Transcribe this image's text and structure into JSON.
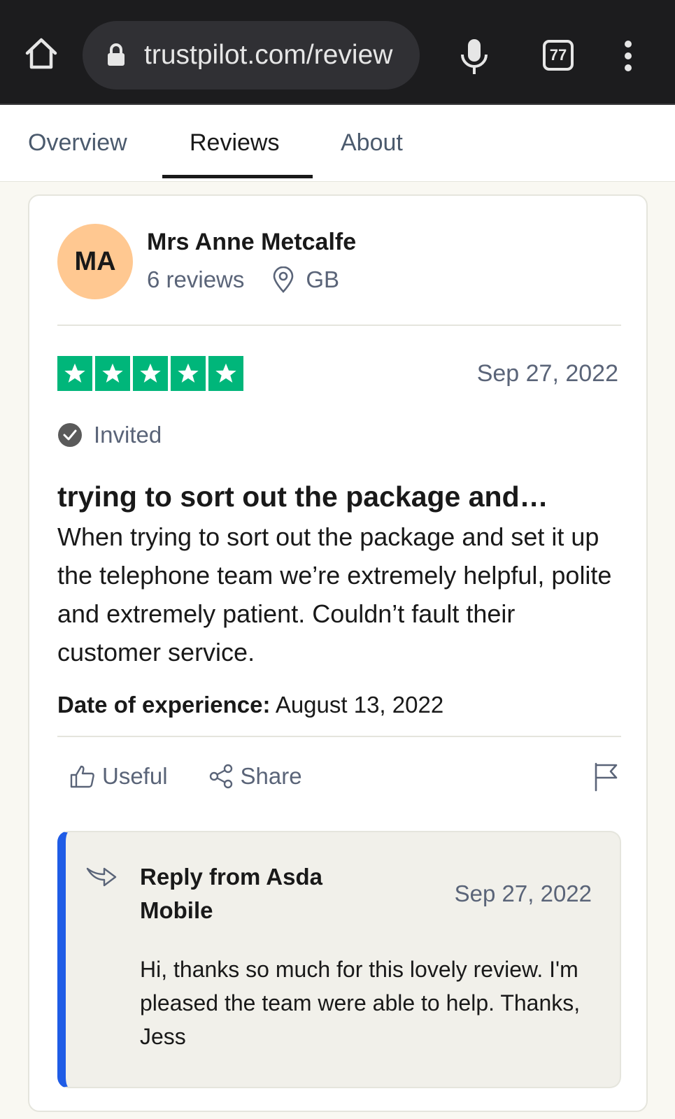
{
  "browser": {
    "url": "trustpilot.com/review",
    "tab_count": "77"
  },
  "nav": {
    "tabs": [
      {
        "label": "Overview",
        "active": false
      },
      {
        "label": "Reviews",
        "active": true
      },
      {
        "label": "About",
        "active": false
      }
    ]
  },
  "review": {
    "avatar_initials": "MA",
    "avatar_color": "#ffc891",
    "reviewer_name": "Mrs Anne Metcalfe",
    "reviewer_review_count": "6 reviews",
    "reviewer_country": "GB",
    "rating": 5,
    "rating_max": 5,
    "star_color": "#00b67a",
    "date": "Sep 27, 2022",
    "badge": "Invited",
    "title": "trying to sort out the package and…",
    "body": "When trying to sort out the package and set it up the telephone team we’re extremely helpful, polite and extremely patient. Couldn’t fault their customer service.",
    "experience_label": "Date of experience:",
    "experience_date": "August 13, 2022",
    "useful_label": "Useful",
    "share_label": "Share"
  },
  "reply": {
    "from": "Reply from Asda Mobile",
    "date": "Sep 27, 2022",
    "body": "Hi, thanks so much for this lovely review. I'm pleased the team were able to help. Thanks, Jess",
    "accent_color": "#1f5ce6"
  }
}
